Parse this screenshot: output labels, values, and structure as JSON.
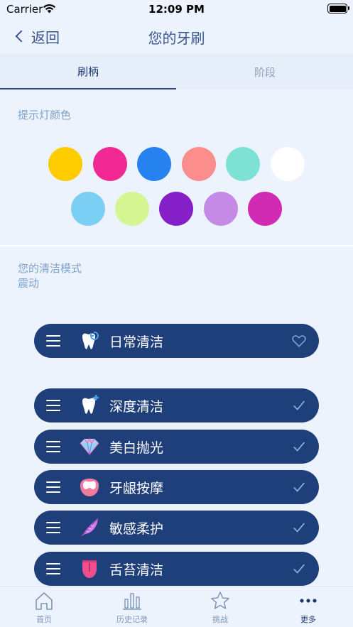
{
  "status_bar": {
    "carrier": "Carrier",
    "time": "12:09 PM"
  },
  "nav": {
    "back_label": "返回",
    "title": "您的牙刷"
  },
  "tabs": [
    {
      "label": "刷柄",
      "active": true
    },
    {
      "label": "阶段",
      "active": false
    }
  ],
  "light_color": {
    "label": "提示灯颜色",
    "colors": [
      "#ffcc00",
      "#f22995",
      "#2582ee",
      "#fb8d8d",
      "#7de1d3",
      "#ffffff",
      "#7ccff4",
      "#d5f592",
      "#8520c8",
      "#c58ae5",
      "#d12ab3"
    ]
  },
  "cleaning_mode": {
    "label": "您的清洁模式",
    "sub_label": "震动",
    "default_mode": {
      "label": "日常清洁",
      "icon": "tooth-refresh-icon",
      "status_icon": "heart-icon"
    },
    "modes": [
      {
        "label": "深度清洁",
        "icon": "tooth-plus-icon",
        "status_icon": "check-icon"
      },
      {
        "label": "美白抛光",
        "icon": "diamond-icon",
        "status_icon": "check-icon"
      },
      {
        "label": "牙龈按摩",
        "icon": "gum-icon",
        "status_icon": "check-icon"
      },
      {
        "label": "敏感柔护",
        "icon": "feather-icon",
        "status_icon": "check-icon"
      },
      {
        "label": "舌苔清洁",
        "icon": "tongue-icon",
        "status_icon": "check-icon"
      }
    ]
  },
  "tab_bar": [
    {
      "label": "首页",
      "icon": "home-icon",
      "active": false
    },
    {
      "label": "历史记录",
      "icon": "bar-chart-icon",
      "active": false
    },
    {
      "label": "挑战",
      "icon": "star-icon",
      "active": false
    },
    {
      "label": "更多",
      "icon": "more-dots-icon",
      "active": true
    }
  ],
  "colors": {
    "background": "#edf3fc",
    "pill": "#1f3f7a",
    "accent": "#7ea2cc",
    "title": "#3a5690"
  }
}
